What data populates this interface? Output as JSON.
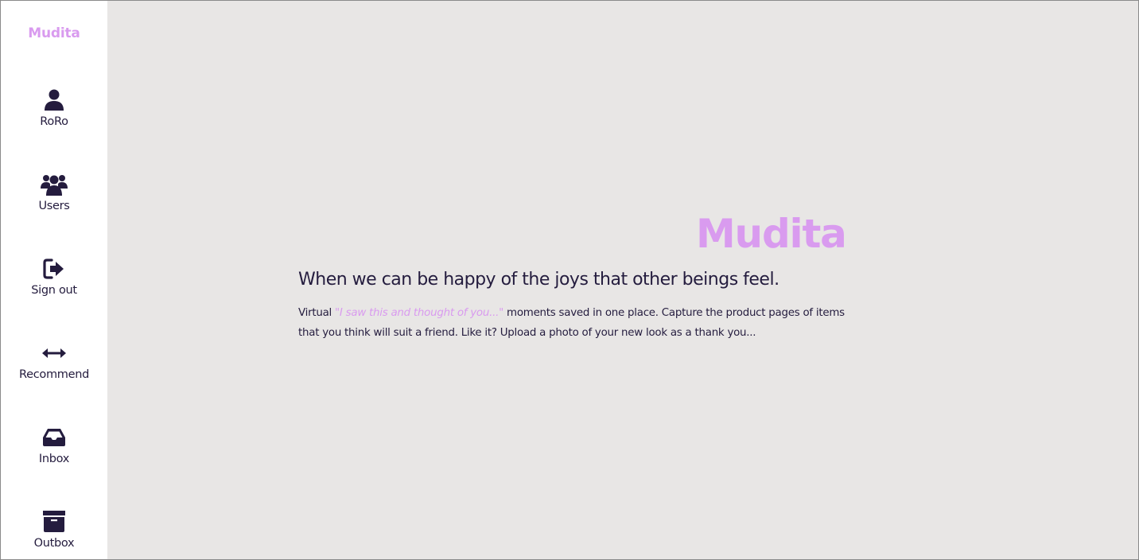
{
  "colors": {
    "accent": "#d99bef",
    "text": "#241c3e",
    "background": "#e8e6e5",
    "sidebar": "#ffffff"
  },
  "sidebar": {
    "brand": "Mudita",
    "items": [
      {
        "label": "RoRo",
        "icon": "user-icon"
      },
      {
        "label": "Users",
        "icon": "users-icon"
      },
      {
        "label": "Sign out",
        "icon": "sign-out-icon"
      },
      {
        "label": "Recommend",
        "icon": "arrows-horizontal-icon"
      },
      {
        "label": "Inbox",
        "icon": "inbox-icon"
      },
      {
        "label": "Outbox",
        "icon": "archive-box-icon"
      }
    ]
  },
  "main": {
    "title": "Mudita",
    "tagline": "When we can be happy of the joys that other beings feel.",
    "description": {
      "prefix": "Virtual ",
      "quote": "\"I saw this and thought of you...\"",
      "suffix": " moments saved in one place. Capture the product pages of items that you think will suit a friend. Like it? Upload a photo of your new look as a thank you..."
    }
  }
}
